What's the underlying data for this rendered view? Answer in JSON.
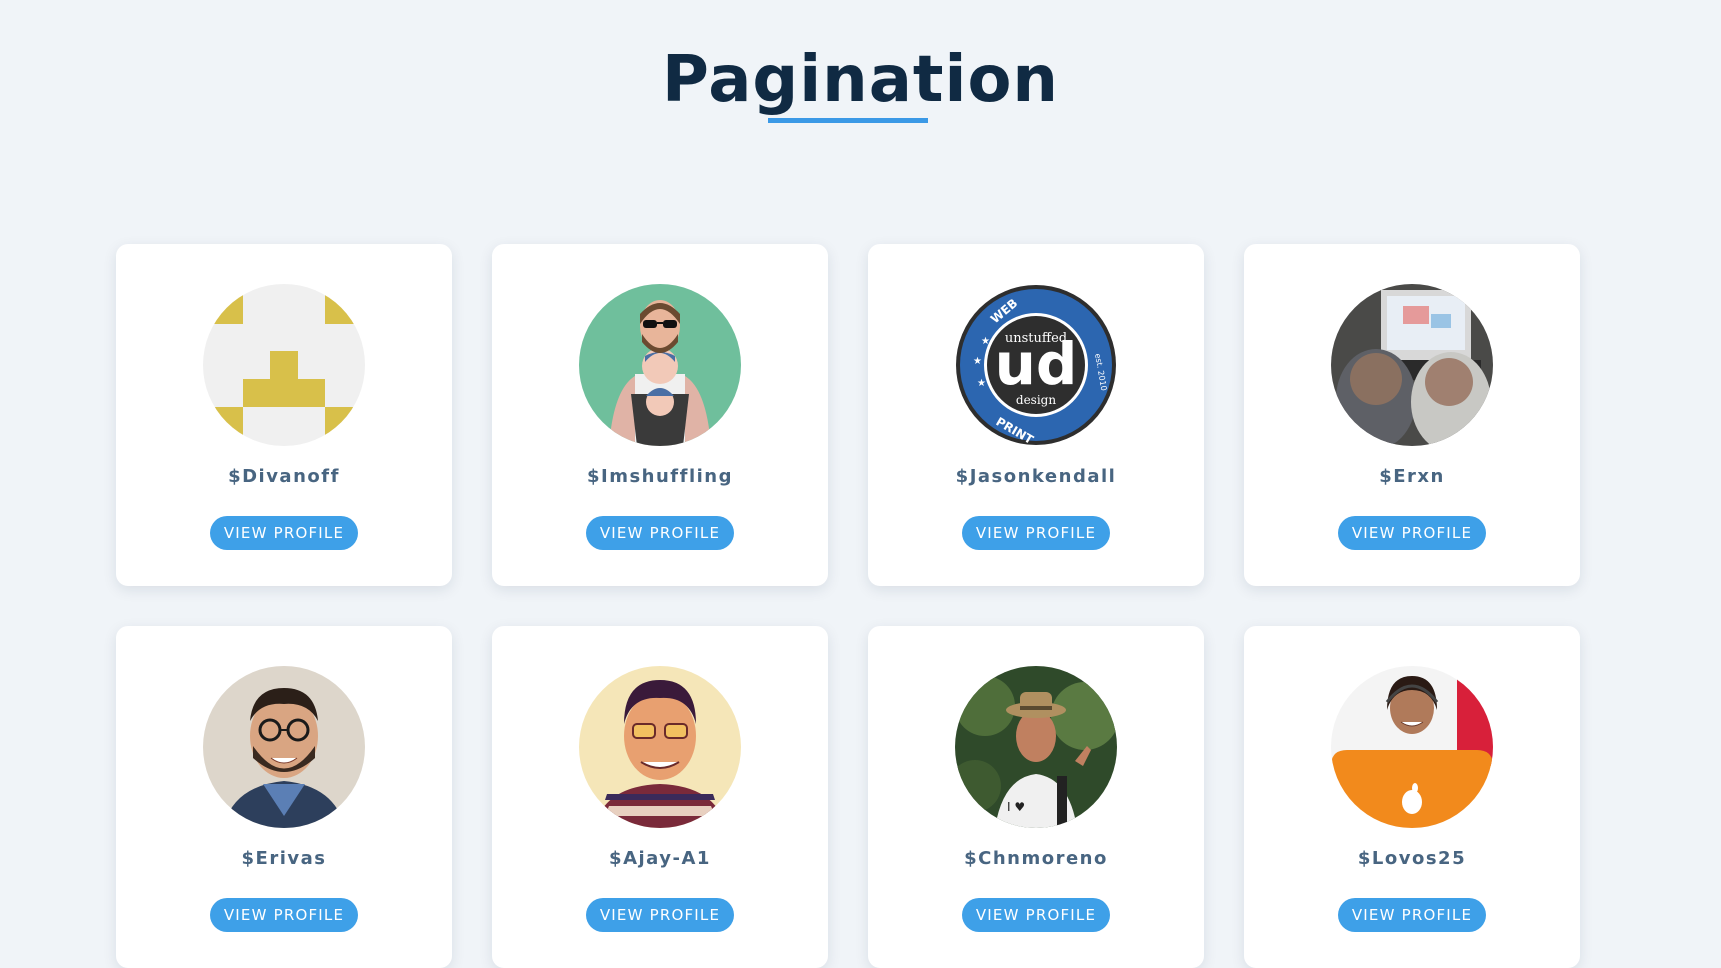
{
  "header": {
    "title": "Pagination",
    "accent_color": "#3b99e6"
  },
  "cards": [
    {
      "username": "$Divanoff",
      "button_label": "VIEW PROFILE",
      "avatar": "identicon-avatar"
    },
    {
      "username": "$Imshuffling",
      "button_label": "VIEW PROFILE",
      "avatar": "father-with-baby-avatar"
    },
    {
      "username": "$Jasonkendall",
      "button_label": "VIEW PROFILE",
      "avatar": "ud-design-logo-avatar"
    },
    {
      "username": "$Erxn",
      "button_label": "VIEW PROFILE",
      "avatar": "kids-at-computer-avatar"
    },
    {
      "username": "$Erivas",
      "button_label": "VIEW PROFILE",
      "avatar": "smiling-man-glasses-avatar"
    },
    {
      "username": "$Ajay-A1",
      "button_label": "VIEW PROFILE",
      "avatar": "illustrated-man-glasses-avatar"
    },
    {
      "username": "$Chnmoreno",
      "button_label": "VIEW PROFILE",
      "avatar": "man-hat-thumbs-up-avatar"
    },
    {
      "username": "$Lovos25",
      "button_label": "VIEW PROFILE",
      "avatar": "woman-with-laptop-avatar"
    }
  ],
  "logo_text": {
    "ud_main": "ud",
    "ud_sub": "unstuffed",
    "ud_design": "design",
    "ud_web": "WEB",
    "ud_print": "PRINT",
    "ud_est": "est. 2010"
  }
}
